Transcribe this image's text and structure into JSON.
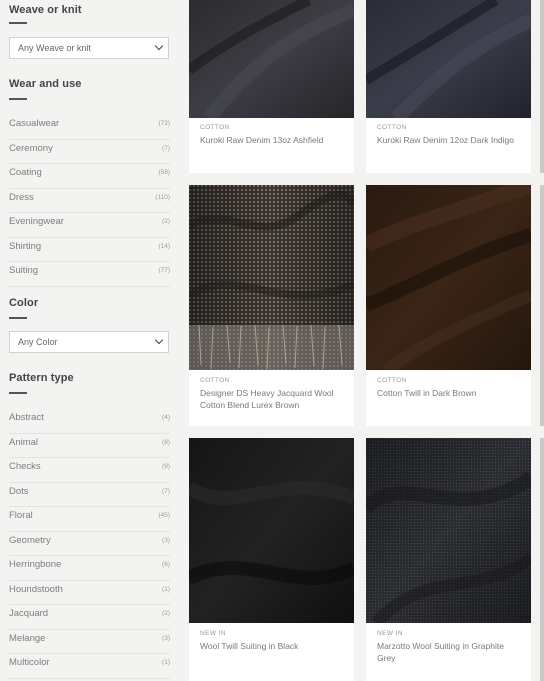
{
  "sidebar": {
    "weave": {
      "title": "Weave or knit",
      "select_value": "Any Weave or knit"
    },
    "wear": {
      "title": "Wear and use",
      "items": [
        {
          "label": "Casualwear",
          "count": "(72)"
        },
        {
          "label": "Ceremony",
          "count": "(7)"
        },
        {
          "label": "Coating",
          "count": "(58)"
        },
        {
          "label": "Dress",
          "count": "(110)"
        },
        {
          "label": "Eveningwear",
          "count": "(2)"
        },
        {
          "label": "Shirting",
          "count": "(14)"
        },
        {
          "label": "Suiting",
          "count": "(77)"
        }
      ]
    },
    "color": {
      "title": "Color",
      "select_value": "Any Color"
    },
    "pattern": {
      "title": "Pattern type",
      "items": [
        {
          "label": "Abstract",
          "count": "(4)"
        },
        {
          "label": "Animal",
          "count": "(8)"
        },
        {
          "label": "Checks",
          "count": "(9)"
        },
        {
          "label": "Dots",
          "count": "(7)"
        },
        {
          "label": "Floral",
          "count": "(45)"
        },
        {
          "label": "Geometry",
          "count": "(3)"
        },
        {
          "label": "Herringbone",
          "count": "(6)"
        },
        {
          "label": "Houndstooth",
          "count": "(1)"
        },
        {
          "label": "Jacquard",
          "count": "(2)"
        },
        {
          "label": "Melange",
          "count": "(3)"
        },
        {
          "label": "Multicolor",
          "count": "(1)"
        }
      ]
    }
  },
  "products": [
    {
      "tag": "COTTON",
      "name": "Kuroki Raw Denim 13oz Ashfield",
      "swatch": "denim-ashfield"
    },
    {
      "tag": "COTTON",
      "name": "Kuroki Raw Denim 12oz Dark Indigo",
      "swatch": "denim-indigo"
    },
    {
      "tag": "COTTON",
      "name": "Designer DS Heavy Jacquard Wool Cotton Blend Lurex Brown",
      "swatch": "jacquard-lurex"
    },
    {
      "tag": "COTTON",
      "name": "Cotton Twill in Dark Brown",
      "swatch": "twill-brown"
    },
    {
      "tag": "NEW IN",
      "name": "Wool Twill Suiting in Black",
      "swatch": "wool-black"
    },
    {
      "tag": "NEW IN",
      "name": "Marzotto Wool Suiting in Graphite Grey",
      "swatch": "wool-graphite"
    }
  ],
  "colors": {
    "page_bg": "#f3f3f1",
    "accent_rule": "#555555"
  }
}
